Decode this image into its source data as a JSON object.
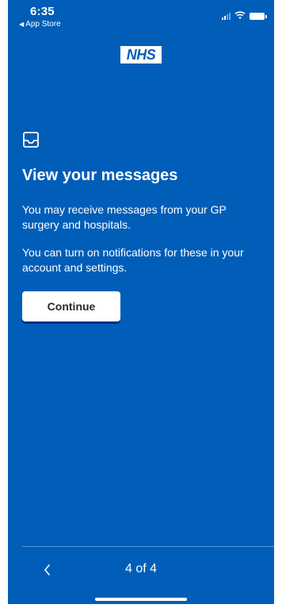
{
  "status_bar": {
    "time": "6:35",
    "back_app_label": "App Store",
    "icons": [
      "signal-icon",
      "wifi-icon",
      "battery-icon"
    ]
  },
  "header": {
    "logo_text": "NHS"
  },
  "main": {
    "icon": "inbox-icon",
    "title": "View your messages",
    "paragraphs": [
      "You may receive messages from your GP surgery and hospitals.",
      "You can turn on notifications for these in your account and settings."
    ],
    "continue_label": "Continue"
  },
  "footer": {
    "prev_icon": "chevron-left-icon",
    "page_indicator": "4 of 4"
  },
  "colors": {
    "background": "#005eb8",
    "text": "#ffffff",
    "button_bg": "#ffffff",
    "button_text": "#212b32"
  }
}
